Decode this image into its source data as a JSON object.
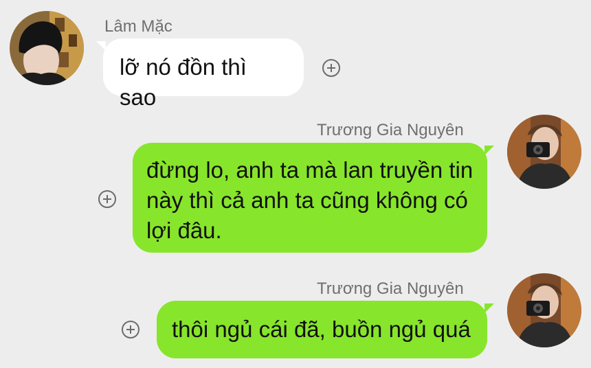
{
  "messages": [
    {
      "side": "left",
      "sender": "Lâm Mặc",
      "text": "lỡ nó đồn thì sao",
      "avatar": "dark-haired-man-avatar"
    },
    {
      "side": "right",
      "sender": "Trương Gia Nguyên",
      "text": "đừng lo, anh ta mà lan truyền tin này thì cả anh ta cũng không có lợi đâu.",
      "avatar": "man-with-camera-avatar"
    },
    {
      "side": "right",
      "sender": "Trương Gia Nguyên",
      "text": "thôi ngủ cái đã, buồn ngủ quá",
      "avatar": "man-with-camera-avatar"
    }
  ],
  "colors": {
    "background": "#ededed",
    "sent_bubble": "#87e52b",
    "received_bubble": "#ffffff",
    "name_text": "#6f6f6f"
  },
  "icons": {
    "add": "plus-circle-icon"
  }
}
